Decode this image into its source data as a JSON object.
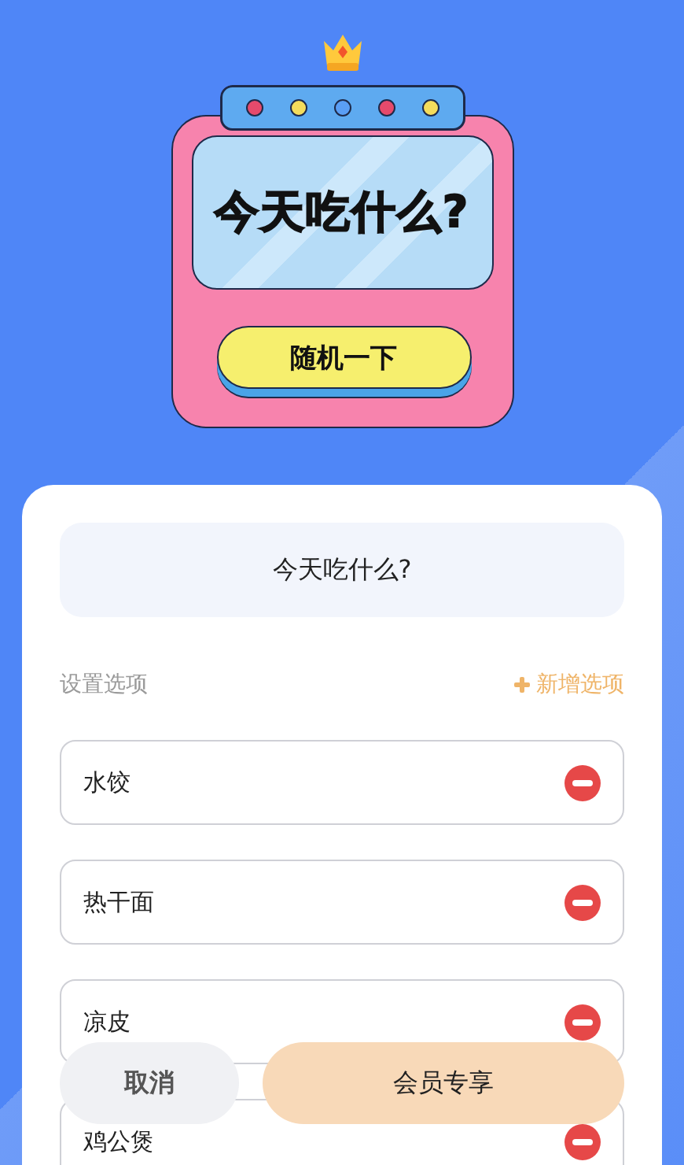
{
  "machine": {
    "screen_text": "今天吃什么?",
    "button": "随机一下"
  },
  "title_box": {
    "text": "今天吃什么?"
  },
  "options_section": {
    "label": "设置选项",
    "add_link": "新增选项"
  },
  "options": [
    {
      "name": "水饺"
    },
    {
      "name": "热干面"
    },
    {
      "name": "凉皮"
    },
    {
      "name": "鸡公煲"
    }
  ],
  "actions": {
    "cancel": "取消",
    "member": "会员专享"
  }
}
